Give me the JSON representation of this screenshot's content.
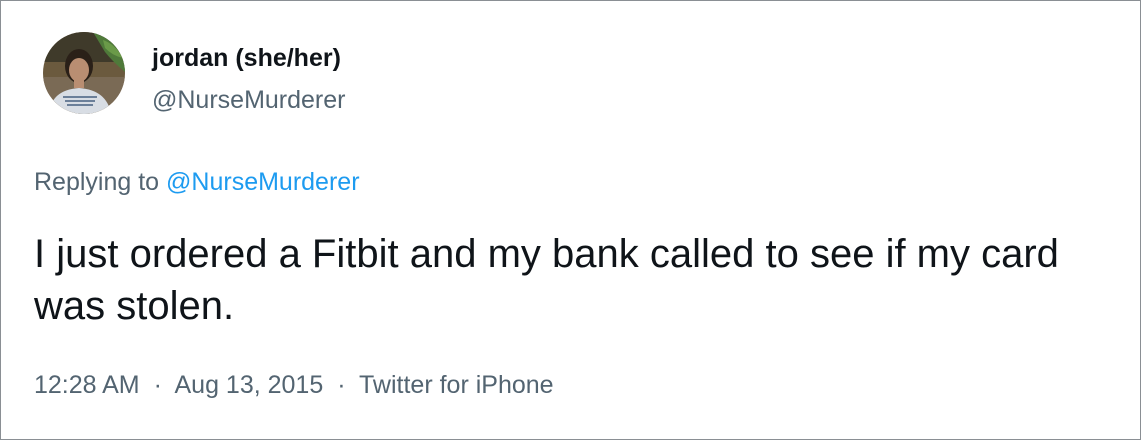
{
  "user": {
    "display_name": "jordan (she/her)",
    "handle": "@NurseMurderer",
    "avatar_icon": "profile-photo"
  },
  "reply": {
    "prefix": "Replying to",
    "mention": "@NurseMurderer"
  },
  "tweet": {
    "text": "I just ordered a Fitbit and my bank called to see if my card was stolen."
  },
  "meta": {
    "time": "12:28 AM",
    "separator": "·",
    "date": "Aug 13, 2015",
    "source": "Twitter for iPhone"
  },
  "colors": {
    "text": "#0f1419",
    "secondary": "#536471",
    "link": "#1d9bf0",
    "border": "#8a8f94"
  }
}
